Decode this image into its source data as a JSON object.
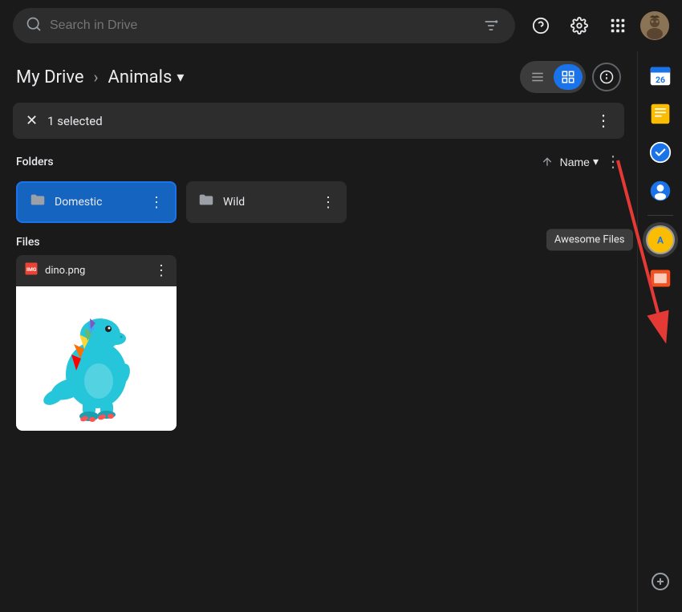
{
  "topbar": {
    "search_placeholder": "Search in Drive"
  },
  "breadcrumb": {
    "root": "My Drive",
    "separator": "›",
    "current": "Animals"
  },
  "view_controls": {
    "list_label": "☰",
    "grid_label": "⊞",
    "info_label": "ⓘ"
  },
  "selection_bar": {
    "count_text": "1 selected"
  },
  "folders_section": {
    "label": "Folders",
    "sort_label": "Name",
    "items": [
      {
        "name": "Domestic",
        "selected": true
      },
      {
        "name": "Wild",
        "selected": false
      }
    ]
  },
  "files_section": {
    "label": "Files",
    "items": [
      {
        "name": "dino.png"
      }
    ]
  },
  "right_sidebar": {
    "apps": [
      {
        "id": "calendar",
        "label": "Calendar"
      },
      {
        "id": "keep",
        "label": "Keep"
      },
      {
        "id": "tasks",
        "label": "Tasks"
      },
      {
        "id": "contacts",
        "label": "Contacts"
      },
      {
        "id": "awesome",
        "label": "Awesome Files"
      },
      {
        "id": "slides",
        "label": "Slides"
      }
    ],
    "add_label": "+"
  },
  "tooltip": {
    "text": "Awesome Files"
  },
  "colors": {
    "selected_folder_bg": "#1565c0",
    "accent": "#1a73e8",
    "text_primary": "#e8eaed",
    "text_secondary": "#9aa0a6",
    "surface": "#2d2d2d",
    "background": "#1a1a1a"
  }
}
